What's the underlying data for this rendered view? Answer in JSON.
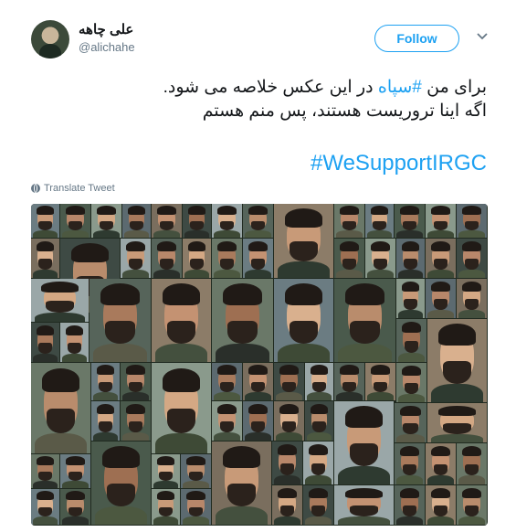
{
  "user": {
    "display_name": "علی چاهه",
    "handle": "@alichahe"
  },
  "follow_button_label": "Follow",
  "tweet": {
    "line1_prefix": "برای من ",
    "line1_hashtag": "#سپاه",
    "line1_suffix": " در این عکس خلاصه می شود.",
    "line2": "اگه اینا تروریست هستند، پس منم هستم",
    "hashtag_line": "#WeSupportIRGC"
  },
  "translate_label": "Translate Tweet",
  "colors": {
    "accent": "#1da1f2",
    "secondary_text": "#657786"
  },
  "icons": {
    "menu": "chevron-down-icon",
    "translate": "globe-icon"
  }
}
